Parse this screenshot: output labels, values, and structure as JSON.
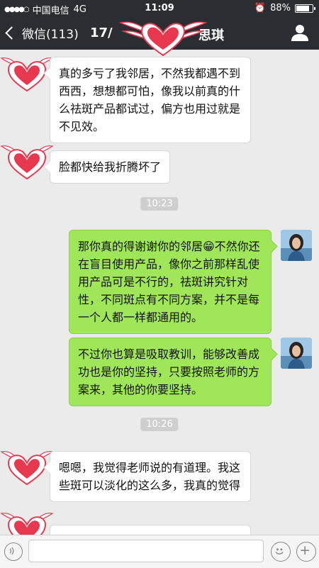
{
  "status_bar": {
    "carrier": "中国电信",
    "network": "4G",
    "time": "11:09",
    "battery_text": "88%",
    "battery_level": 0.88
  },
  "nav": {
    "back_label": "微信(113)",
    "title_left": "17/",
    "title_right": "思琪"
  },
  "messages": [
    {
      "side": "in",
      "text": "真的多亏了我邻居，不然我都遇不到西西，想想都可怕，像我以前真的什么祛斑产品都试过，偏方也用过就是不见效。"
    },
    {
      "side": "in",
      "text": "脸都快给我折腾坏了"
    },
    {
      "type": "time",
      "text": "10:23"
    },
    {
      "side": "out",
      "text": "那你真的得谢谢你的邻居😁不然你还在盲目使用产品，像你之前那样乱使用产品可是不行的，祛斑讲究针对性，不同斑点有不同方案，并不是每一个人都一样都通用的。"
    },
    {
      "side": "out",
      "text": "不过你也算是吸取教训，能够改善成功也是你的坚持，只要按照老师的方案来，其他的你要坚持。"
    },
    {
      "type": "time",
      "text": "10:26"
    },
    {
      "side": "in",
      "text": "嗯嗯，我觉得老师说的有道理。我这些斑可以淡化的这么多，我真的觉得"
    }
  ],
  "colors": {
    "header_bg": "#2a2e33",
    "chat_bg": "#ebebeb",
    "out_bubble": "#9fe658",
    "in_bubble": "#ffffff",
    "heart": "#e8384f"
  }
}
